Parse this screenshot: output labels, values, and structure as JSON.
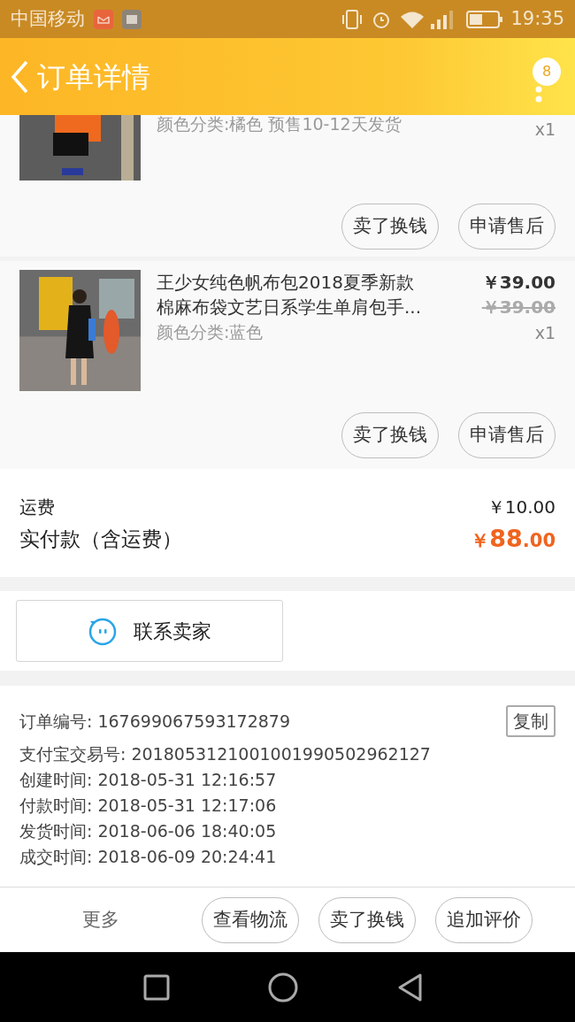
{
  "status_bar": {
    "carrier": "中国移动",
    "time": "19:35"
  },
  "header": {
    "title": "订单详情",
    "badge": "8"
  },
  "products": [
    {
      "spec": "颜色分类:橘色 预售10-12天发货",
      "quantity": "x1",
      "buttons": [
        "卖了换钱",
        "申请售后"
      ]
    },
    {
      "title": "王少女纯色帆布包2018夏季新款棉麻布袋文艺日系学生单肩包手...",
      "price": "￥39.00",
      "original_price": "￥39.00",
      "spec": "颜色分类:蓝色",
      "quantity": "x1",
      "buttons": [
        "卖了换钱",
        "申请售后"
      ]
    }
  ],
  "summary": {
    "shipping_label": "运费",
    "shipping": "￥10.00",
    "total_label": "实付款（含运费）",
    "total": "￥**88**.00"
  },
  "contact_button": "联系卖家",
  "order_info": {
    "copy_button": "复制",
    "lines": [
      "订单编号: 167699067593172879",
      "支付宝交易号: 2018053121001001990502962127",
      "创建时间: 2018-05-31 12:16:57",
      "付款时间: 2018-05-31 12:17:06",
      "发货时间: 2018-06-06 18:40:05",
      "成交时间: 2018-06-09 20:24:41"
    ]
  },
  "bottom_bar": {
    "more": "更多",
    "buttons": [
      "查看物流",
      "卖了换钱",
      "追加评价"
    ]
  }
}
